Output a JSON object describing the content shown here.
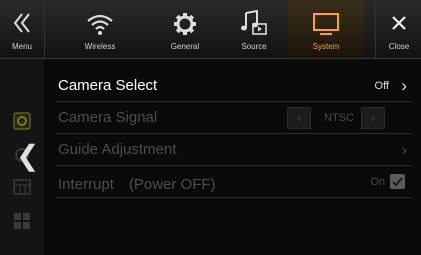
{
  "topbar": {
    "menu_label": "Menu",
    "wireless_label": "Wireless",
    "general_label": "General",
    "source_label": "Source",
    "system_label": "System",
    "close_label": "Close"
  },
  "list": {
    "camera_select": {
      "label": "Camera Select",
      "value": "Off"
    },
    "camera_signal": {
      "label": "Camera Signal",
      "value": "NTSC"
    },
    "guide_adjustment": {
      "label": "Guide Adjustment"
    },
    "interrupt": {
      "label": "Interrupt　(Power OFF)",
      "value": "On"
    }
  },
  "colors": {
    "accent": "#f5a623",
    "active_text": "#ffffff",
    "disabled_text": "#4d4d4d"
  }
}
